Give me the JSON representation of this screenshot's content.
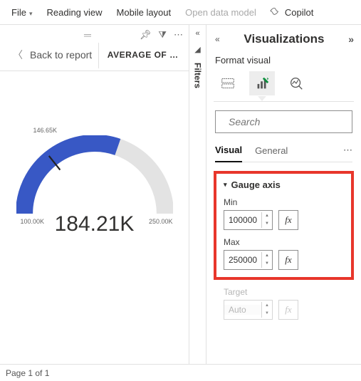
{
  "menu": {
    "file": "File",
    "reading": "Reading view",
    "mobile": "Mobile layout",
    "datamodel": "Open data model",
    "copilot": "Copilot"
  },
  "left": {
    "back": "Back to report",
    "avg": "AVERAGE OF …"
  },
  "filters_label": "Filters",
  "chart_data": {
    "type": "gauge",
    "value_label": "184.21K",
    "needle_label": "146.65K",
    "min_label": "100.00K",
    "max_label": "250.00K",
    "min": 100000,
    "max": 250000,
    "value": 184210,
    "needle": 146650
  },
  "viz": {
    "title": "Visualizations",
    "subtitle": "Format visual",
    "search_placeholder": "Search",
    "tabs": {
      "visual": "Visual",
      "general": "General"
    },
    "section": "Gauge axis",
    "min": {
      "label": "Min",
      "value": "100000"
    },
    "max": {
      "label": "Max",
      "value": "250000"
    },
    "target": {
      "label": "Target",
      "value": "Auto"
    },
    "fx": "fx"
  },
  "status": "Page 1 of 1"
}
